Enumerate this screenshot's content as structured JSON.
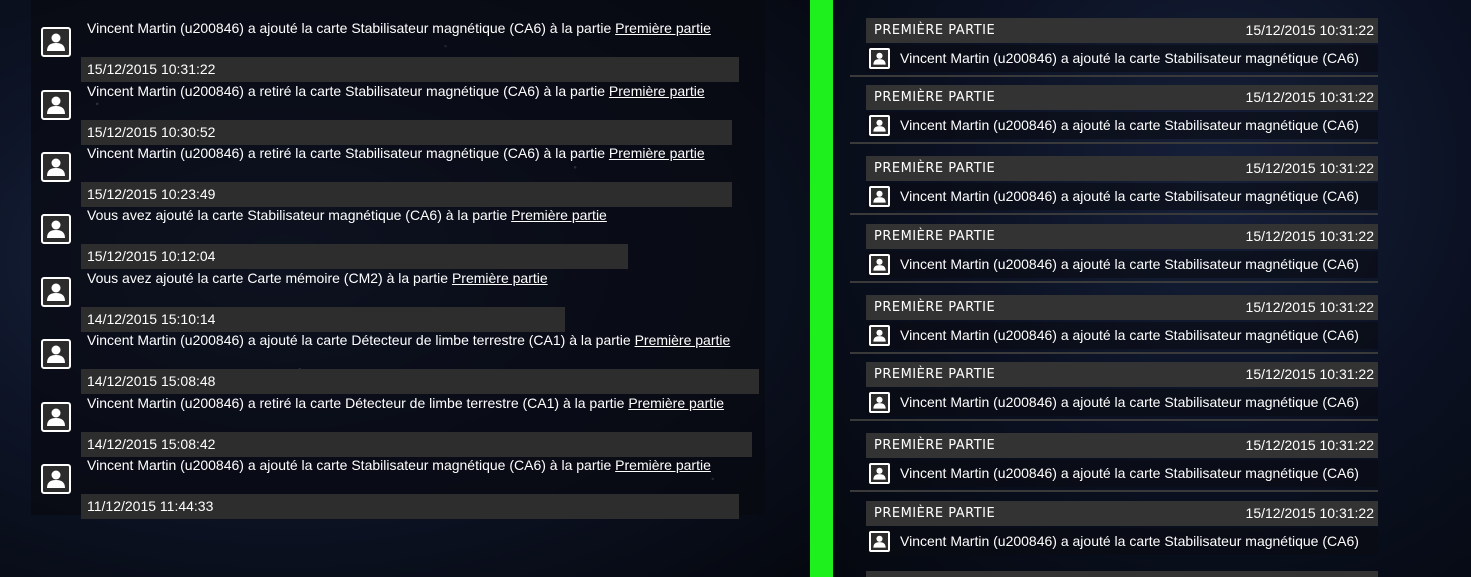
{
  "left_feed": {
    "items": [
      {
        "text": "Vincent Martin (u200846) a ajouté la carte Stabilisateur magnétique (CA6) à la partie ",
        "link": "Première partie",
        "date": "15/12/2015 10:31:22"
      },
      {
        "text": "Vincent Martin (u200846) a retiré la carte Stabilisateur magnétique (CA6) à la partie ",
        "link": "Première partie",
        "date": "15/12/2015 10:30:52"
      },
      {
        "text": "Vincent Martin (u200846) a retiré la carte Stabilisateur magnétique (CA6) à la partie ",
        "link": "Première partie",
        "date": "15/12/2015 10:23:49"
      },
      {
        "text": "Vous avez ajouté la carte Stabilisateur magnétique (CA6) à la partie ",
        "link": "Première partie",
        "date": "15/12/2015 10:12:04"
      },
      {
        "text": "Vous avez ajouté la carte Carte mémoire (CM2) à la partie ",
        "link": "Première partie",
        "date": "14/12/2015 15:10:14"
      },
      {
        "text": "Vincent Martin (u200846) a ajouté la carte Détecteur de limbe terrestre (CA1) à la partie ",
        "link": "Première partie",
        "date": "14/12/2015 15:08:48"
      },
      {
        "text": "Vincent Martin (u200846) a retiré la carte Détecteur de limbe terrestre (CA1) à la partie ",
        "link": "Première partie",
        "date": "14/12/2015 15:08:42"
      },
      {
        "text": "Vincent Martin (u200846) a ajouté la carte Stabilisateur magnétique (CA6) à la partie ",
        "link": "Première partie",
        "date": "11/12/2015 11:44:33"
      }
    ]
  },
  "right_feed": {
    "cards": [
      {
        "game": "PREMIÈRE PARTIE",
        "date": "15/12/2015 10:31:22",
        "text": "Vincent Martin (u200846) a ajouté la carte Stabilisateur magnétique (CA6)"
      },
      {
        "game": "PREMIÈRE PARTIE",
        "date": "15/12/2015 10:31:22",
        "text": "Vincent Martin (u200846) a ajouté la carte Stabilisateur magnétique (CA6)"
      },
      {
        "game": "PREMIÈRE PARTIE",
        "date": "15/12/2015 10:31:22",
        "text": "Vincent Martin (u200846) a ajouté la carte Stabilisateur magnétique (CA6)"
      },
      {
        "game": "PREMIÈRE PARTIE",
        "date": "15/12/2015 10:31:22",
        "text": "Vincent Martin (u200846) a ajouté la carte Stabilisateur magnétique (CA6)"
      },
      {
        "game": "PREMIÈRE PARTIE",
        "date": "15/12/2015 10:31:22",
        "text": "Vincent Martin (u200846) a ajouté la carte Stabilisateur magnétique (CA6)"
      },
      {
        "game": "PREMIÈRE PARTIE",
        "date": "15/12/2015 10:31:22",
        "text": "Vincent Martin (u200846) a ajouté la carte Stabilisateur magnétique (CA6)"
      },
      {
        "game": "PREMIÈRE PARTIE",
        "date": "15/12/2015 10:31:22",
        "text": "Vincent Martin (u200846) a ajouté la carte Stabilisateur magnétique (CA6)"
      },
      {
        "game": "PREMIÈRE PARTIE",
        "date": "15/12/2015 10:31:22",
        "text": "Vincent Martin (u200846) a ajouté la carte Stabilisateur magnétique (CA6)"
      }
    ]
  },
  "colors": {
    "divider": "#1df01d",
    "date_bar": "#2d2d2d",
    "card_header": "#333333"
  },
  "icons": {
    "avatar": "user-avatar-icon"
  }
}
